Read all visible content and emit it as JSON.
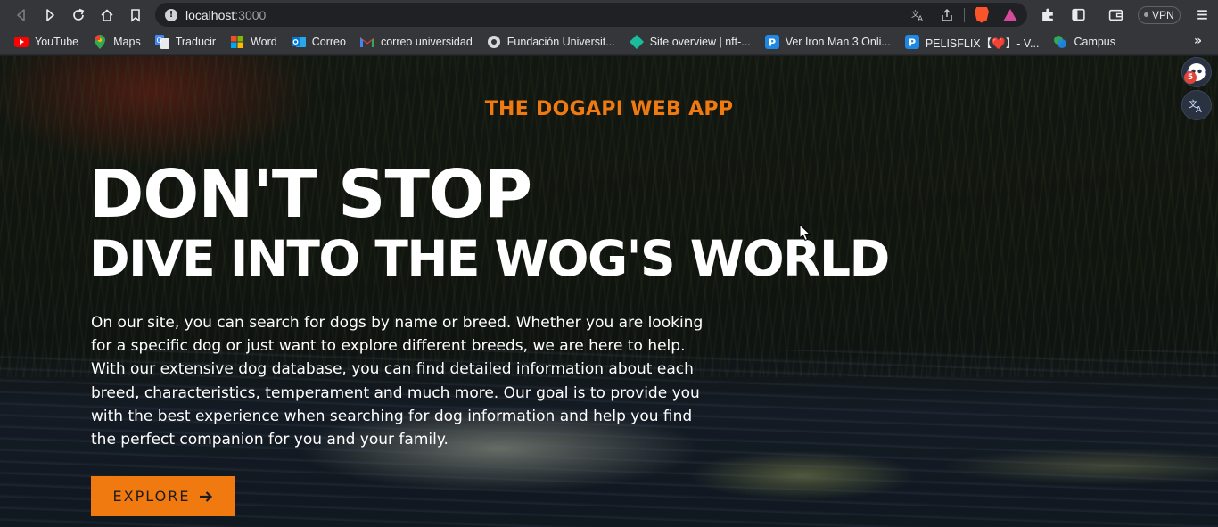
{
  "browser": {
    "url_host": "localhost",
    "url_port": ":3000",
    "vpn_label": "VPN",
    "bookmarks": [
      {
        "label": "YouTube",
        "icon": "youtube-icon",
        "color": "#ff0000"
      },
      {
        "label": "Maps",
        "icon": "maps-pin-icon",
        "color": "#34a853"
      },
      {
        "label": "Traducir",
        "icon": "translate-icon",
        "color": "#4285f4"
      },
      {
        "label": "Word",
        "icon": "microsoft-windows-icon",
        "color": "#f25022"
      },
      {
        "label": "Correo",
        "icon": "outlook-icon",
        "color": "#0078d4"
      },
      {
        "label": "correo universidad",
        "icon": "gmail-icon",
        "color": "#ea4335"
      },
      {
        "label": "Fundación Universit...",
        "icon": "globe-icon",
        "color": "#9aa0a6"
      },
      {
        "label": "Site overview | nft-...",
        "icon": "diamond-icon",
        "color": "#1abc9c"
      },
      {
        "label": "Ver Iron Man 3 Onli...",
        "icon": "p-letter-icon",
        "color": "#1e88e5"
      },
      {
        "label": "PELISFLIX【❤️】- V...",
        "icon": "p-letter-icon",
        "color": "#1e88e5"
      },
      {
        "label": "Campus",
        "icon": "campus-icon",
        "color": "#34a853"
      }
    ]
  },
  "page": {
    "site_title": "THE DOGAPI WEB APP",
    "hero_line_1": "DON'T STOP",
    "hero_line_2": "DIVE INTO THE WOG'S WORLD",
    "description": "On our site, you can search for dogs by name or breed. Whether you are looking for a specific dog or just want to explore different breeds, we are here to help. With our extensive dog database, you can find detailed information about each breed, characteristics, temperament and much more. Our goal is to provide you with the best experience when searching for dog information and help you find the perfect companion for you and your family.",
    "explore_label": "EXPLORE",
    "extension_badge_count": "5"
  },
  "colors": {
    "accent": "#f07a10",
    "hero_text": "#ffffff"
  }
}
